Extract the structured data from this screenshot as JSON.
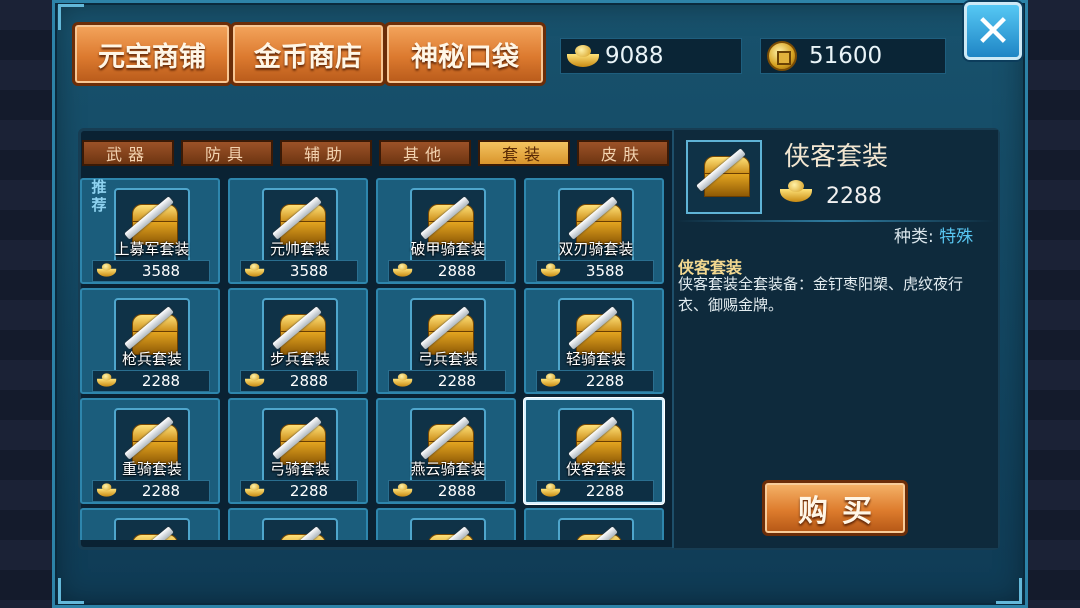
{
  "shop_tabs": [
    {
      "label": "元宝商铺"
    },
    {
      "label": "金币商店"
    },
    {
      "label": "神秘口袋"
    }
  ],
  "currency": {
    "ingot_amount": "9088",
    "gold_amount": "51600"
  },
  "close_label": "✕",
  "category_tabs": [
    {
      "label": "武器"
    },
    {
      "label": "防具"
    },
    {
      "label": "辅助"
    },
    {
      "label": "其他"
    },
    {
      "label": "套装",
      "active": true
    },
    {
      "label": "皮肤"
    }
  ],
  "recommend_label": "推荐",
  "items": [
    {
      "name": "上募军套装",
      "price": "3588"
    },
    {
      "name": "元帅套装",
      "price": "3588"
    },
    {
      "name": "破甲骑套装",
      "price": "2888"
    },
    {
      "name": "双刃骑套装",
      "price": "3588"
    },
    {
      "name": "枪兵套装",
      "price": "2288"
    },
    {
      "name": "步兵套装",
      "price": "2888"
    },
    {
      "name": "弓兵套装",
      "price": "2288"
    },
    {
      "name": "轻骑套装",
      "price": "2288"
    },
    {
      "name": "重骑套装",
      "price": "2288"
    },
    {
      "name": "弓骑套装",
      "price": "2288"
    },
    {
      "name": "燕云骑套装",
      "price": "2888"
    },
    {
      "name": "侠客套装",
      "price": "2288",
      "selected": true
    }
  ],
  "detail": {
    "title": "侠客套装",
    "price": "2288",
    "type_label": "种类:",
    "type_value": "特殊",
    "desc_title": "侠客套装",
    "desc_body": "侠客套装全套装备：金钉枣阳槊、虎纹夜行衣、御赐金牌。"
  },
  "buy_label": "购买",
  "colors": {
    "frame": "#18526d",
    "tab_orange": "#dc7a2f",
    "active_category": "#f4c360",
    "type_value": "#58c6f1"
  },
  "icons": {
    "ingot": "gold-ingot-icon",
    "coin": "gold-coin-icon",
    "item": "treasure-chest-sword-icon"
  }
}
